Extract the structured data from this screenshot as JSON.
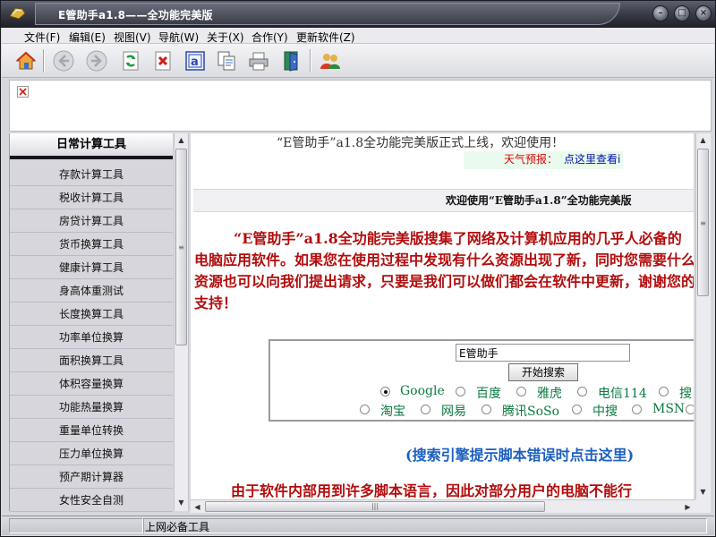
{
  "window": {
    "title": "E管助手a1.8——全功能完美版",
    "buttons": [
      "minimize",
      "maximize",
      "close"
    ]
  },
  "menu": {
    "items": [
      "文件(F)",
      "编辑(E)",
      "视图(V)",
      "导航(W)",
      "关于(X)",
      "合作(Y)",
      "更新软件(Z)"
    ]
  },
  "toolbar": {
    "icons": [
      "home-icon",
      "back-icon",
      "forward-icon",
      "refresh-icon",
      "stop-icon",
      "address-icon",
      "copy-icon",
      "print-icon",
      "exit-icon",
      "users-icon"
    ]
  },
  "sidebar": {
    "header": "日常计算工具",
    "items": [
      "存款计算工具",
      "税收计算工具",
      "房贷计算工具",
      "货币换算工具",
      "健康计算工具",
      "身高体重测试",
      "长度换算工具",
      "功率单位换算",
      "面积换算工具",
      "体积容量换算",
      "功能热量换算",
      "重量单位转换",
      "压力单位换算",
      "预产期计算器",
      "女性安全自测"
    ]
  },
  "content": {
    "welcome": "“E管助手”a1.8全功能完美版正式上线，欢迎使用！",
    "weather_label": "天气预报：",
    "weather_link": "点这里查看i",
    "section_title": "欢迎使用“E管助手a1.8”全功能完美版",
    "intro": "“E管助手”a1.8全功能完美版搜集了网络及计算机应用的几乎人必备的电脑应用软件。如果您在使用过程中发现有什么资源出现了新，同时您需要什么资源也可以向我们提出请求，只要是我们可以做们都会在软件中更新，谢谢您的支持！",
    "search": {
      "input_value": "E管助手",
      "button": "开始搜索",
      "row1": [
        "Google",
        "百度",
        "雅虎",
        "电信114",
        "搜"
      ],
      "row2": [
        "淘宝",
        "网易",
        "腾讯SoSo",
        "中搜",
        "MSN",
        ""
      ],
      "selected": "Google"
    },
    "error_link": "(搜索引擎提示脚本错误时点击这里)",
    "bottom_note": "由于软件内部用到许多脚本语言，因此对部分用户的电脑不能行"
  },
  "statusbar": {
    "text": "上网必备工具"
  },
  "colors": {
    "title_bar": "#3b3d48",
    "intro_red": "#b30d0d",
    "link_blue": "#1c5fbf",
    "engine_green": "#0b7a3f",
    "weather_red": "#e00000"
  }
}
